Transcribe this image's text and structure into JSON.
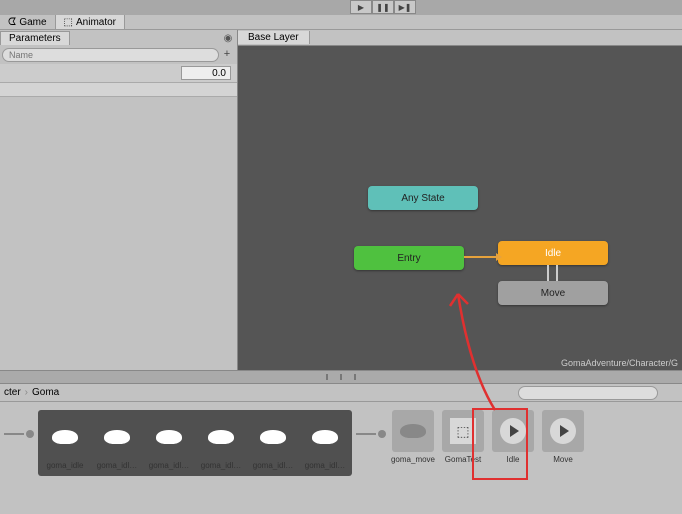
{
  "tabs": {
    "game": "Game",
    "animator": "Animator"
  },
  "left": {
    "header": "Parameters",
    "searchPlaceholder": "Name",
    "paramValue": "0.0"
  },
  "graph": {
    "layer": "Base Layer",
    "nodes": {
      "any": "Any State",
      "entry": "Entry",
      "idle": "Idle",
      "move": "Move"
    },
    "path": "GomaAdventure/Character/G"
  },
  "breadcrumb": {
    "parent": "cter",
    "child": "Goma"
  },
  "assets": {
    "sprites": [
      "goma_idle",
      "goma_idl…",
      "goma_idl…",
      "goma_idl…",
      "goma_idl…",
      "goma_idl…"
    ],
    "move": "goma_move",
    "testCtrl": "GomaTest",
    "idleClip": "Idle",
    "moveClip": "Move"
  }
}
